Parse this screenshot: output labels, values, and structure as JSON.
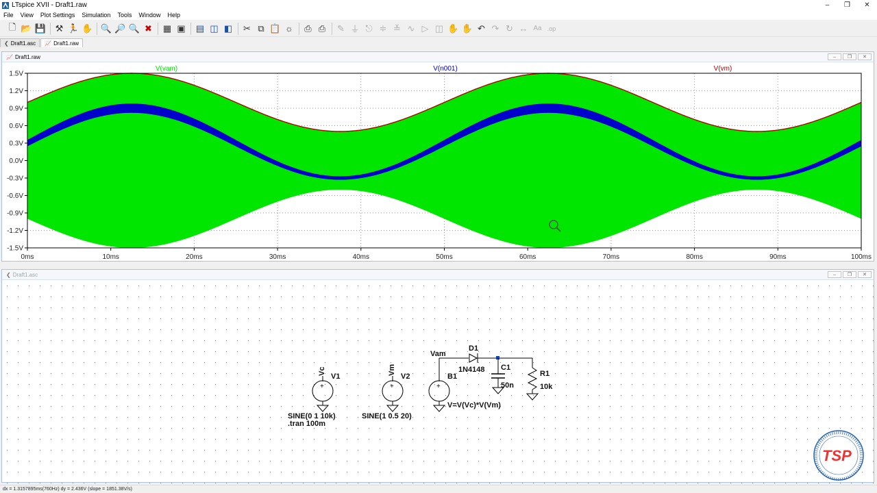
{
  "window": {
    "title": "LTspice XVII - Draft1.raw"
  },
  "menu": [
    "File",
    "View",
    "Plot Settings",
    "Simulation",
    "Tools",
    "Window",
    "Help"
  ],
  "toolbar": {
    "icons": [
      "new-schematic",
      "open",
      "save",
      "control-panel",
      "run",
      "halt",
      "zoom-in",
      "zoom-pan",
      "zoom-out",
      "zoom-fit",
      "autoscale",
      "tile-horizontal",
      "tile-vertical",
      "cascade",
      "cut",
      "copy",
      "paste",
      "find",
      "print",
      "print-setup",
      "wire",
      "ground",
      "label",
      "resistor",
      "capacitor",
      "inductor",
      "diode",
      "component",
      "move",
      "drag",
      "undo",
      "redo",
      "rotate",
      "mirror",
      "text",
      "spice-directive"
    ]
  },
  "tabs": [
    {
      "label": "Draft1.asc",
      "active": false
    },
    {
      "label": "Draft1.raw",
      "active": true
    }
  ],
  "plot_window": {
    "title": "Draft1.raw"
  },
  "schematic_window": {
    "title": "Draft1.asc"
  },
  "chart_data": {
    "type": "line",
    "x_unit": "ms",
    "xlim": [
      0,
      100
    ],
    "ylim": [
      -1.5,
      1.5
    ],
    "x_ticks": [
      "0ms",
      "10ms",
      "20ms",
      "30ms",
      "40ms",
      "50ms",
      "60ms",
      "70ms",
      "80ms",
      "90ms",
      "100ms"
    ],
    "y_ticks": [
      "1.5V",
      "1.2V",
      "0.9V",
      "0.6V",
      "0.3V",
      "0.0V",
      "-0.3V",
      "-0.6V",
      "-0.9V",
      "-1.2V",
      "-1.5V"
    ],
    "grid": true,
    "series": [
      {
        "name": "V(vam)",
        "color": "#00e600",
        "description_shape": "AM carrier 10kHz, envelope 1+0.5*sin(2*pi*20*t)",
        "carrier_hz": 10000,
        "offset": 1,
        "mod_amp": 0.5,
        "mod_hz": 20
      },
      {
        "name": "V(n001)",
        "color": "#0000cc",
        "offset": 0.3,
        "amp": 0.6,
        "mod_hz": 20
      },
      {
        "name": "V(vm)",
        "color": "#b00000",
        "offset": 1,
        "amp": 0.5,
        "mod_hz": 20
      }
    ]
  },
  "schematic": {
    "labels": {
      "vc_net": "Vc",
      "v1": "V1",
      "v1_val": "SINE(0 1 10k)",
      "tran": ".tran 100m",
      "vm_net": "Vm",
      "v2": "V2",
      "v2_val": "SINE(1 0.5 20)",
      "vam_net": "Vam",
      "b1": "B1",
      "b1_val": "V=V(Vc)*V(Vm)",
      "d1": "D1",
      "d1_val": "1N4148",
      "c1": "C1",
      "c1_val": "50n",
      "r1": "R1",
      "r1_val": "10k"
    }
  },
  "watermark": {
    "logo_text": "TSP",
    "ring_top": "www.tspelettronica.com",
    "ring_bottom": "Electronic systems made in Italy"
  },
  "status": {
    "text": "dx = 1.3157895ms(760Hz)   dy = 2.436V   (slope = 1851.38V/s)"
  }
}
